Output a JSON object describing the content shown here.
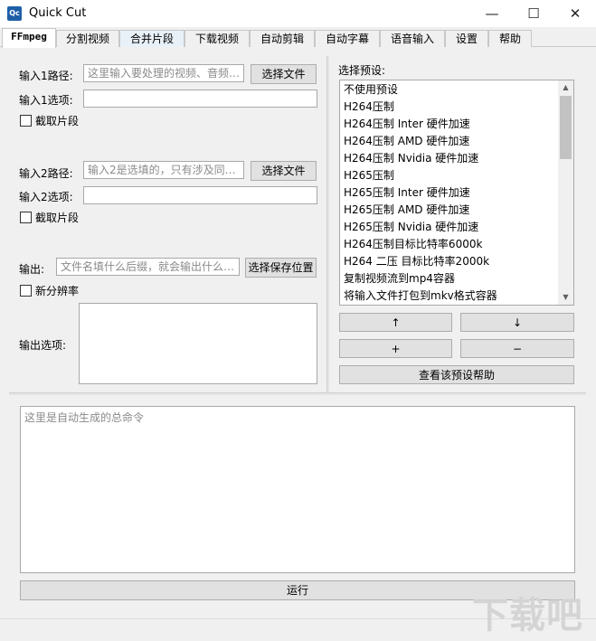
{
  "window": {
    "title": "Quick Cut",
    "icon_text": "Qc",
    "minimize": "—",
    "maximize": "☐",
    "close": "✕"
  },
  "tabs": [
    "FFmpeg",
    "分割视频",
    "合并片段",
    "下载视频",
    "自动剪辑",
    "自动字幕",
    "语音输入",
    "设置",
    "帮助"
  ],
  "input1": {
    "path_label": "输入1路径:",
    "path_placeholder": "这里输入要处理的视频、音频…",
    "select_button": "选择文件",
    "options_label": "输入1选项:",
    "options_value": "",
    "clip_label": "截取片段"
  },
  "input2": {
    "path_label": "输入2路径:",
    "path_placeholder": "输入2是选填的，只有涉及同…",
    "select_button": "选择文件",
    "options_label": "输入2选项:",
    "options_value": "",
    "clip_label": "截取片段"
  },
  "output": {
    "label": "输出:",
    "placeholder": "文件名填什么后缀，就会输出什么…",
    "save_button": "选择保存位置",
    "resolution_label": "新分辨率",
    "options_label": "输出选项:",
    "options_value": ""
  },
  "presets": {
    "label": "选择预设:",
    "items": [
      "不使用预设",
      "H264压制",
      "H264压制 Inter 硬件加速",
      "H264压制 AMD 硬件加速",
      "H264压制 Nvidia 硬件加速",
      "H265压制",
      "H265压制 Inter 硬件加速",
      "H265压制 AMD 硬件加速",
      "H265压制 Nvidia 硬件加速",
      "H264压制目标比特率6000k",
      "H264 二压 目标比特率2000k",
      "复制视频流到mp4容器",
      "将输入文件打包到mkv格式容器"
    ],
    "up_button": "↑",
    "down_button": "↓",
    "add_button": "+",
    "remove_button": "−",
    "help_button": "查看该预设帮助",
    "scroll_up": "▲",
    "scroll_down": "▼"
  },
  "command": {
    "placeholder": "这里是自动生成的总命令"
  },
  "run_button": "运行",
  "watermark": "下载吧"
}
